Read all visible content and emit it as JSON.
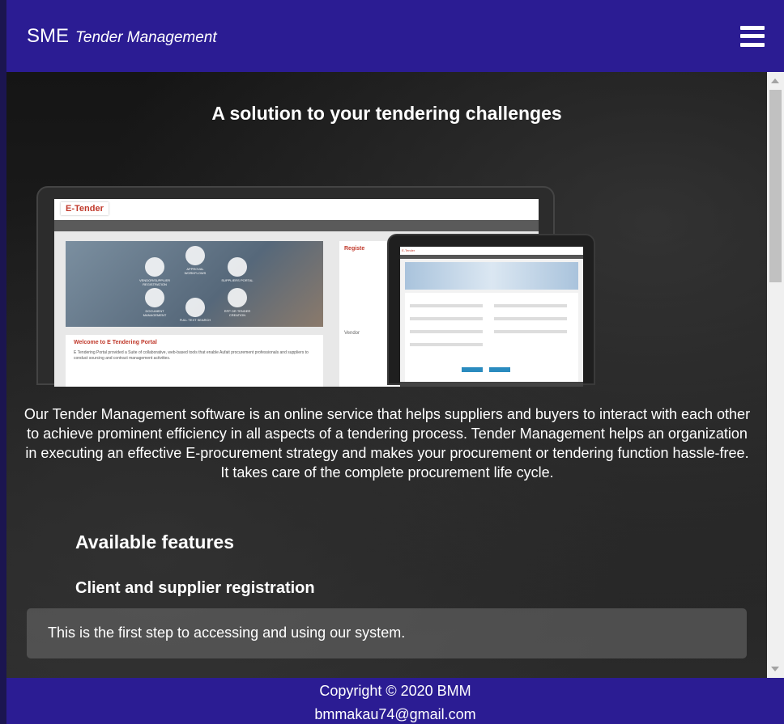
{
  "navbar": {
    "brand_main": "SME",
    "brand_sub": "Tender Management",
    "menu_icon": "hamburger-menu-icon"
  },
  "hero": {
    "title": "A solution to your tendering challenges"
  },
  "mockup": {
    "laptop_logo": "E-Tender",
    "laptop_welcome_title": "Welcome to E Tendering Portal",
    "laptop_welcome_text": "E Tendering Portal provided a Suite of collaborative, web-based tools that enable Aufait procurement professionals and suppliers to conduct sourcing and contract management activities.",
    "laptop_side_title": "Registe",
    "laptop_side_sub": "Vendor",
    "tablet_header": "E-Tender",
    "circles": [
      "VENDOR/SUPPLIER REGISTRATION",
      "APPROVAL WORKFLOWS",
      "SUPPLIERS PORTAL",
      "DOCUMENT MANAGEMENT",
      "FULL TEXT SEARCH",
      "RFP OR TENDER CREATION"
    ]
  },
  "intro": {
    "text": "Our Tender Management software is an online service that helps suppliers and buyers to interact with each other to achieve prominent efficiency in all aspects of a tendering process. Tender Management helps an organization in executing an effective E-procurement strategy and makes your procurement or tendering function hassle-free. It takes care of the complete procurement life cycle."
  },
  "features": {
    "title": "Available features",
    "items": [
      {
        "name": "Client and supplier registration",
        "description": "This is the first step to accessing and using our system."
      }
    ]
  },
  "footer": {
    "copyright": "Copyright © 2020 BMM",
    "email": "bmmakau74@gmail.com"
  },
  "colors": {
    "navbar_bg": "#2b1c93",
    "footer_bg": "#2b1c93",
    "text": "#ffffff"
  }
}
